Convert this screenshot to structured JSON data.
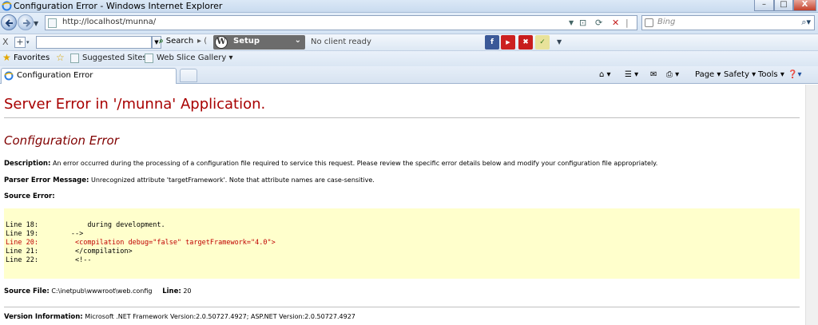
{
  "window": {
    "title": "Configuration Error - Windows Internet Explorer",
    "controls": {
      "minimize": "–",
      "maximize": "□",
      "close": "X"
    }
  },
  "address_bar": {
    "url": "http://localhost/munna/",
    "search_placeholder": "Bing"
  },
  "toolbar": {
    "close_label": "X",
    "add_label": "+",
    "search_label": "Search",
    "setup_label": "Setup",
    "status_text": "No client ready"
  },
  "favorites_bar": {
    "favorites_label": "Favorites",
    "items": [
      "Suggested Sites ▾",
      "Web Slice Gallery ▾"
    ]
  },
  "tabs": [
    {
      "label": "Configuration Error"
    }
  ],
  "command_bar": {
    "page_label": "Page ▾",
    "safety_label": "Safety ▾",
    "tools_label": "Tools ▾"
  },
  "error_page": {
    "heading": "Server Error in '/munna' Application.",
    "subheading": "Configuration Error",
    "description_label": "Description:",
    "description_text": "An error occurred during the processing of a configuration file required to service this request. Please review the specific error details below and modify your configuration file appropriately.",
    "parser_label": "Parser Error Message:",
    "parser_text": "Unrecognized attribute 'targetFramework'. Note that attribute names are case-sensitive.",
    "source_error_label": "Source Error:",
    "source_lines": [
      {
        "text": "Line 18:            during development.",
        "highlight": false
      },
      {
        "text": "Line 19:        -->",
        "highlight": false
      },
      {
        "text": "Line 20:         <compilation debug=\"false\" targetFramework=\"4.0\">",
        "highlight": true
      },
      {
        "text": "Line 21:         </compilation>",
        "highlight": false
      },
      {
        "text": "Line 22:         <!--",
        "highlight": false
      }
    ],
    "source_file_label": "Source File:",
    "source_file_value": "C:\\inetpub\\wwwroot\\web.config",
    "line_label": "Line:",
    "line_value": "20",
    "version_label": "Version Information:",
    "version_text": "Microsoft .NET Framework Version:2.0.50727.4927; ASP.NET Version:2.0.50727.4927"
  }
}
